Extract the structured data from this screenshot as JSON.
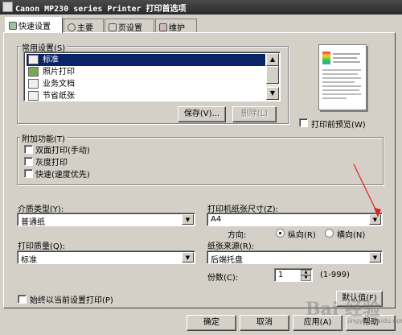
{
  "window": {
    "title": "Canon MP230 series Printer 打印首选项"
  },
  "tabs": [
    {
      "label": "快速设置",
      "icon": "quick-setup-icon"
    },
    {
      "label": "主要",
      "icon": "main-icon"
    },
    {
      "label": "页设置",
      "icon": "page-setup-icon"
    },
    {
      "label": "维护",
      "icon": "maintenance-icon"
    }
  ],
  "common_settings": {
    "label": "常用设置(S)",
    "items": [
      "标准",
      "照片打印",
      "业务文档",
      "节省纸张"
    ],
    "selected": "标准",
    "save_button": "保存(V)...",
    "delete_button": "删除(L)"
  },
  "preview": {
    "checkbox_label": "打印前预览(W)"
  },
  "additional_features": {
    "label": "附加功能(T)",
    "items": [
      "双面打印(手动)",
      "灰度打印",
      "快速(速度优先)"
    ]
  },
  "media_type": {
    "label": "介质类型(Y):",
    "value": "普通纸"
  },
  "paper_size": {
    "label": "打印机纸张尺寸(Z):",
    "value": "A4"
  },
  "orientation": {
    "label": "方向:",
    "portrait": "纵向(R)",
    "landscape": "横向(N)",
    "selected": "portrait"
  },
  "print_quality": {
    "label": "打印质量(Q):",
    "value": "标准"
  },
  "paper_source": {
    "label": "纸张来源(R):",
    "value": "后端托盘"
  },
  "copies": {
    "label": "份数(C):",
    "value": "1",
    "range": "(1-999)"
  },
  "always_print": {
    "label": "始终以当前设置打印(P)"
  },
  "defaults_button": "默认值(F)",
  "footer": {
    "ok": "确定",
    "cancel": "取消",
    "apply": "应用(A)",
    "help": "帮助"
  },
  "watermark": {
    "text": "Bai 经验",
    "url": "jingyan.baidu.com"
  },
  "annotation": {
    "color": "#e02020"
  }
}
